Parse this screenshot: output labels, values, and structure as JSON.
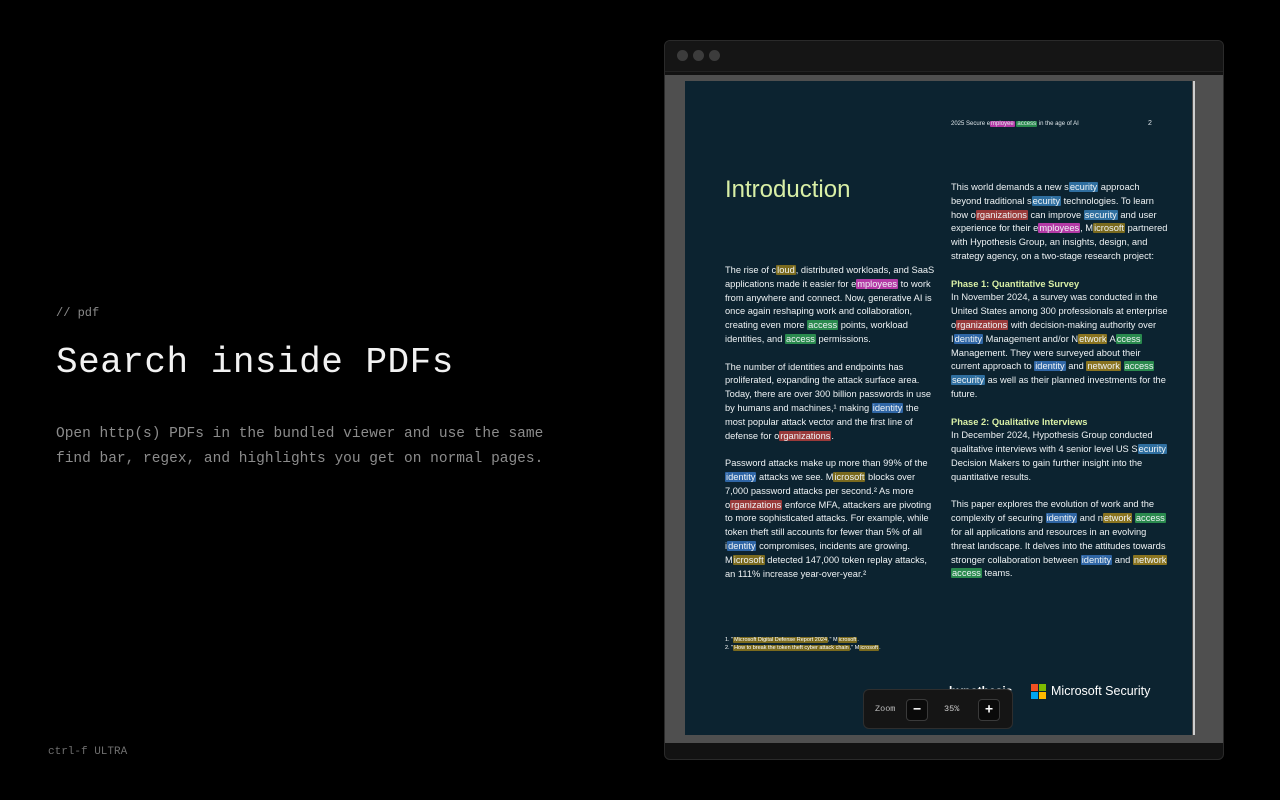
{
  "hero": {
    "eyebrow": "// pdf",
    "title": "Search inside PDFs",
    "description": "Open http(s) PDFs in the bundled viewer and use the same find bar, regex, and highlights you get on normal pages."
  },
  "brand": {
    "name": "ctrl-f ULTRA"
  },
  "viewer": {
    "zoom": {
      "label": "Zoom",
      "value": "35%",
      "minus_icon": "minus-icon",
      "plus_icon": "plus-icon"
    },
    "highlight_colors": {
      "microsoft": "#7a6a1e",
      "security": "#2f6fa0",
      "employees": "#b43aa6",
      "access": "#2a8a4e",
      "organizations": "#9a3a3a",
      "identity": "#2f66a6",
      "network": "#8a7420"
    }
  },
  "pdf": {
    "running_head": "2025 Secure employee access in the age of AI",
    "page_number": "2",
    "heading": "Introduction",
    "logo_partner": "hypothesis",
    "logo_microsoft": "Microsoft Security"
  }
}
